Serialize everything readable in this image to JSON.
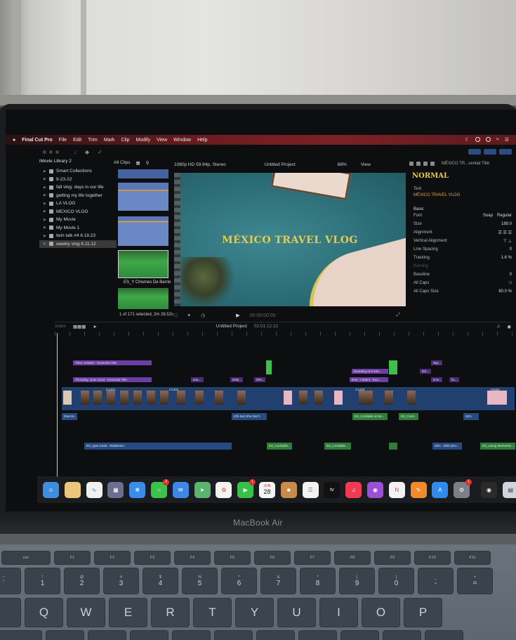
{
  "menubar": {
    "app": "Final Cut Pro",
    "items": [
      "File",
      "Edit",
      "Trim",
      "Mark",
      "Clip",
      "Modify",
      "View",
      "Window",
      "Help"
    ]
  },
  "library": {
    "name": "iMovie Library 2",
    "events": [
      "Smart Collections",
      "9-23-22",
      "fall vlog: days in our life",
      "getting my life together",
      "LA VLOG",
      "MEXICO VLOG",
      "My Movie",
      "My Movie 1",
      "twin talk #4 6.18.23",
      "weekly vlog 6.11.12"
    ]
  },
  "browser": {
    "filter": "All Clips",
    "clip_label": "ES_Y Chismes De Barrio",
    "selection": "1 of 171 selected, 2m 28.52s"
  },
  "viewer": {
    "format": "1080p HD 59.94p, Stereo",
    "project": "Untitled Project",
    "zoom": "68%",
    "view": "View",
    "title_text": "MÉXICO TRAVEL VLOG",
    "timecode": "00:00:00:00"
  },
  "inspector": {
    "path": "MÉXICO TR...sential Title",
    "preset": "NORMAL",
    "text_label": "Text",
    "text_value": "MÉXICO TRAVEL VLOG",
    "section": "Basic",
    "props": [
      {
        "name": "Font",
        "value": "Soap",
        "value2": "Regular"
      },
      {
        "name": "Size",
        "value": "189.0"
      },
      {
        "name": "Alignment",
        "value": ""
      },
      {
        "name": "Vertical Alignment",
        "value": ""
      },
      {
        "name": "Line Spacing",
        "value": "0"
      },
      {
        "name": "Tracking",
        "value": "1.6 %"
      },
      {
        "name": "Kerning",
        "value": ""
      },
      {
        "name": "Baseline",
        "value": "0"
      },
      {
        "name": "All Caps",
        "value": ""
      },
      {
        "name": "All Caps Size",
        "value": "80.0 %"
      }
    ]
  },
  "timeline": {
    "index": "Index",
    "project": "Untitled Project",
    "duration": "02:01:12:22",
    "titles": [
      "Time: 5:50am - Essential Title",
      "Thursday, June 22nd - Essential Title",
      "Boarding at 8:10a...",
      "time: 7:25am - Ess...",
      "ENB...",
      "DRI...",
      "ana...",
      "BO...",
      "dep...",
      "time...",
      "fa..."
    ],
    "clips": [
      "C1401",
      "C1402",
      "C1420",
      "Pastel"
    ],
    "audio": [
      "ES_Que Onda - Redeemin'",
      "(Oh No) She Don't",
      "ES_Cocktails at Su...",
      "ES_Cock...",
      "ES_Cocktails...",
      "ES_Cocktails...",
      "SZA - Shirt (SU...",
      "ES_Living Memories -...",
      "SZA",
      "Ows M..."
    ]
  },
  "dock": {
    "badges": {
      "messages": "2",
      "facetime": "1",
      "settings": "1"
    },
    "calendar_month": "JUN",
    "calendar_day": "28",
    "tv_label": "tv"
  },
  "laptop": {
    "brand": "MacBook Air"
  },
  "keyboard": {
    "fkeys": [
      "esc",
      "F1",
      "F2",
      "F3",
      "F4",
      "F5",
      "F6",
      "F7",
      "F8",
      "F9",
      "F10",
      "F11"
    ],
    "num_row": [
      [
        "~",
        "`"
      ],
      [
        "!",
        "1"
      ],
      [
        "@",
        "2"
      ],
      [
        "#",
        "3"
      ],
      [
        "$",
        "4"
      ],
      [
        "%",
        "5"
      ],
      [
        "^",
        "6"
      ],
      [
        "&",
        "7"
      ],
      [
        "*",
        "8"
      ],
      [
        "(",
        "9"
      ],
      [
        ")",
        "0"
      ],
      [
        "_",
        "-"
      ],
      [
        "+",
        "="
      ]
    ],
    "letters": [
      "Q",
      "W",
      "E",
      "R",
      "T",
      "Y",
      "U",
      "I",
      "O",
      "P"
    ]
  }
}
